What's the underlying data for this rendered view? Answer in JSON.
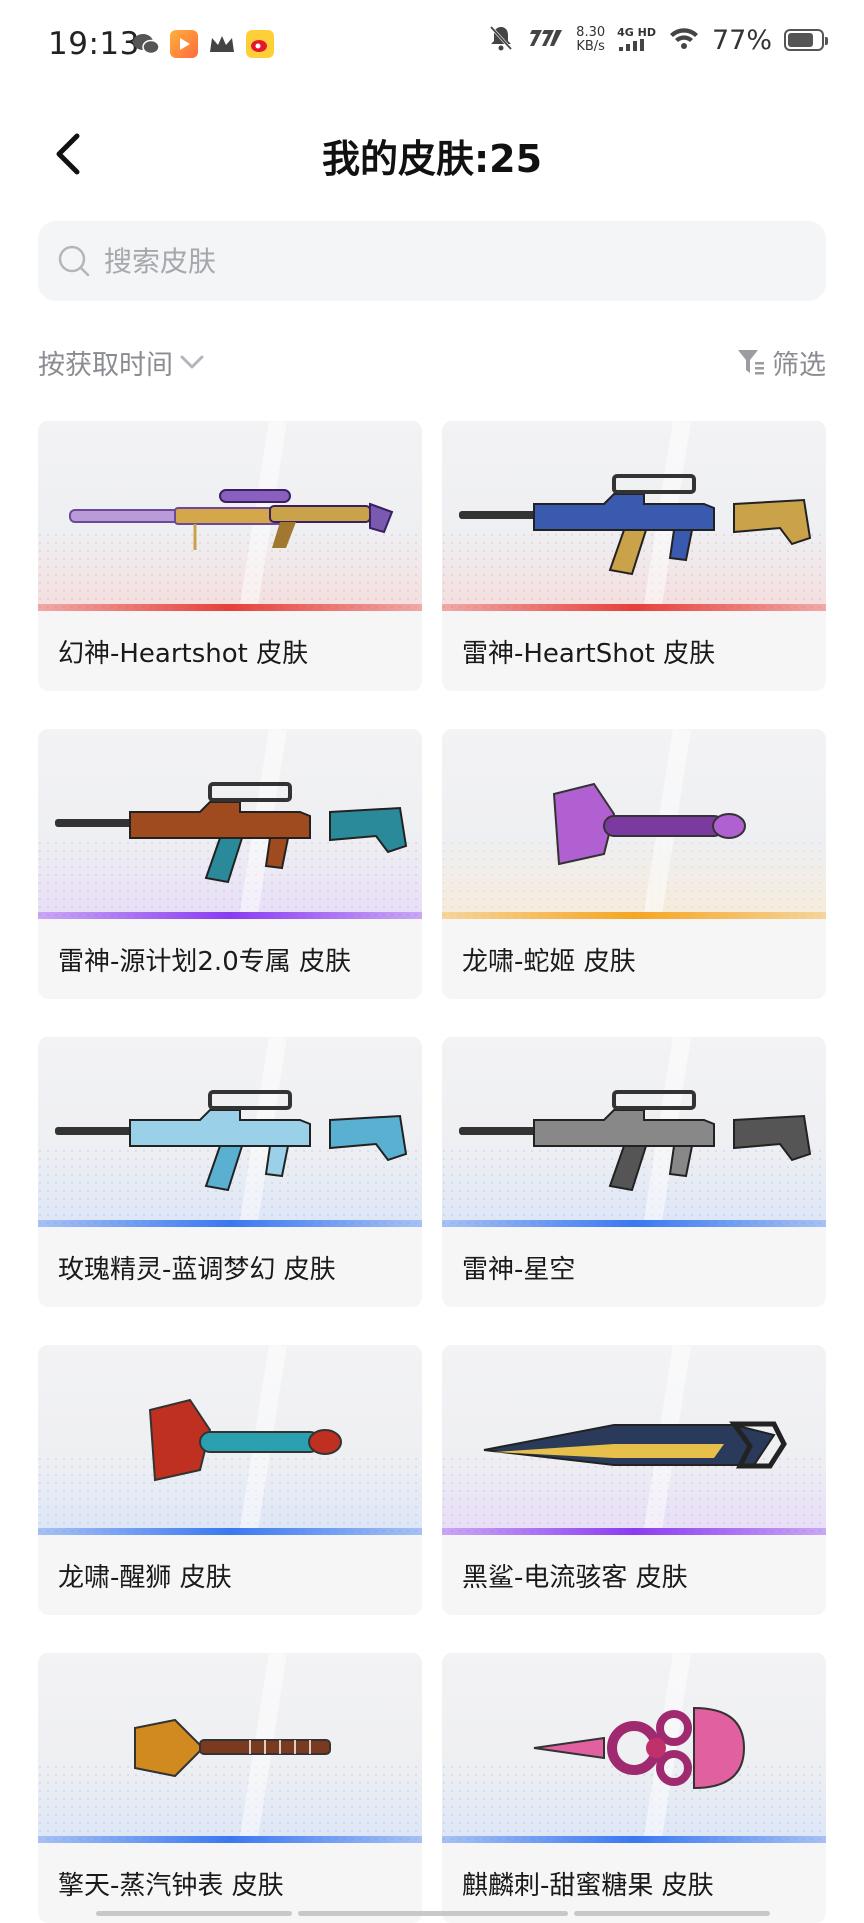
{
  "status_bar": {
    "time": "19:13",
    "speed_top": "8.30",
    "speed_bottom": "KB/s",
    "network_top": "4G HD",
    "battery": "77%"
  },
  "header": {
    "title": "我的皮肤:25"
  },
  "search": {
    "placeholder": "搜索皮肤"
  },
  "sort": {
    "label": "按获取时间"
  },
  "filter": {
    "label": "筛选"
  },
  "colors": {
    "red": "#e6403a",
    "purple": "#8a3cf0",
    "gold": "#f5a623",
    "blue": "#3a78f0"
  },
  "skins": [
    {
      "name": "幻神-Heartshot 皮肤",
      "rarity": "red",
      "weapon": "sniper-rifle"
    },
    {
      "name": "雷神-HeartShot 皮肤",
      "rarity": "red",
      "weapon": "assault-rifle"
    },
    {
      "name": "雷神-源计划2.0专属 皮肤",
      "rarity": "purple",
      "weapon": "assault-rifle"
    },
    {
      "name": "龙啸-蛇姬 皮肤",
      "rarity": "gold",
      "weapon": "axe"
    },
    {
      "name": "玫瑰精灵-蓝调梦幻 皮肤",
      "rarity": "blue",
      "weapon": "assault-rifle"
    },
    {
      "name": "雷神-星空",
      "rarity": "blue",
      "weapon": "assault-rifle"
    },
    {
      "name": "龙啸-醒狮 皮肤",
      "rarity": "blue",
      "weapon": "axe"
    },
    {
      "name": "黑鲨-电流骇客 皮肤",
      "rarity": "purple",
      "weapon": "blade"
    },
    {
      "name": "擎天-蒸汽钟表 皮肤",
      "rarity": "blue",
      "weapon": "shovel"
    },
    {
      "name": "麒麟刺-甜蜜糖果 皮肤",
      "rarity": "blue",
      "weapon": "knuckle-knife"
    }
  ]
}
